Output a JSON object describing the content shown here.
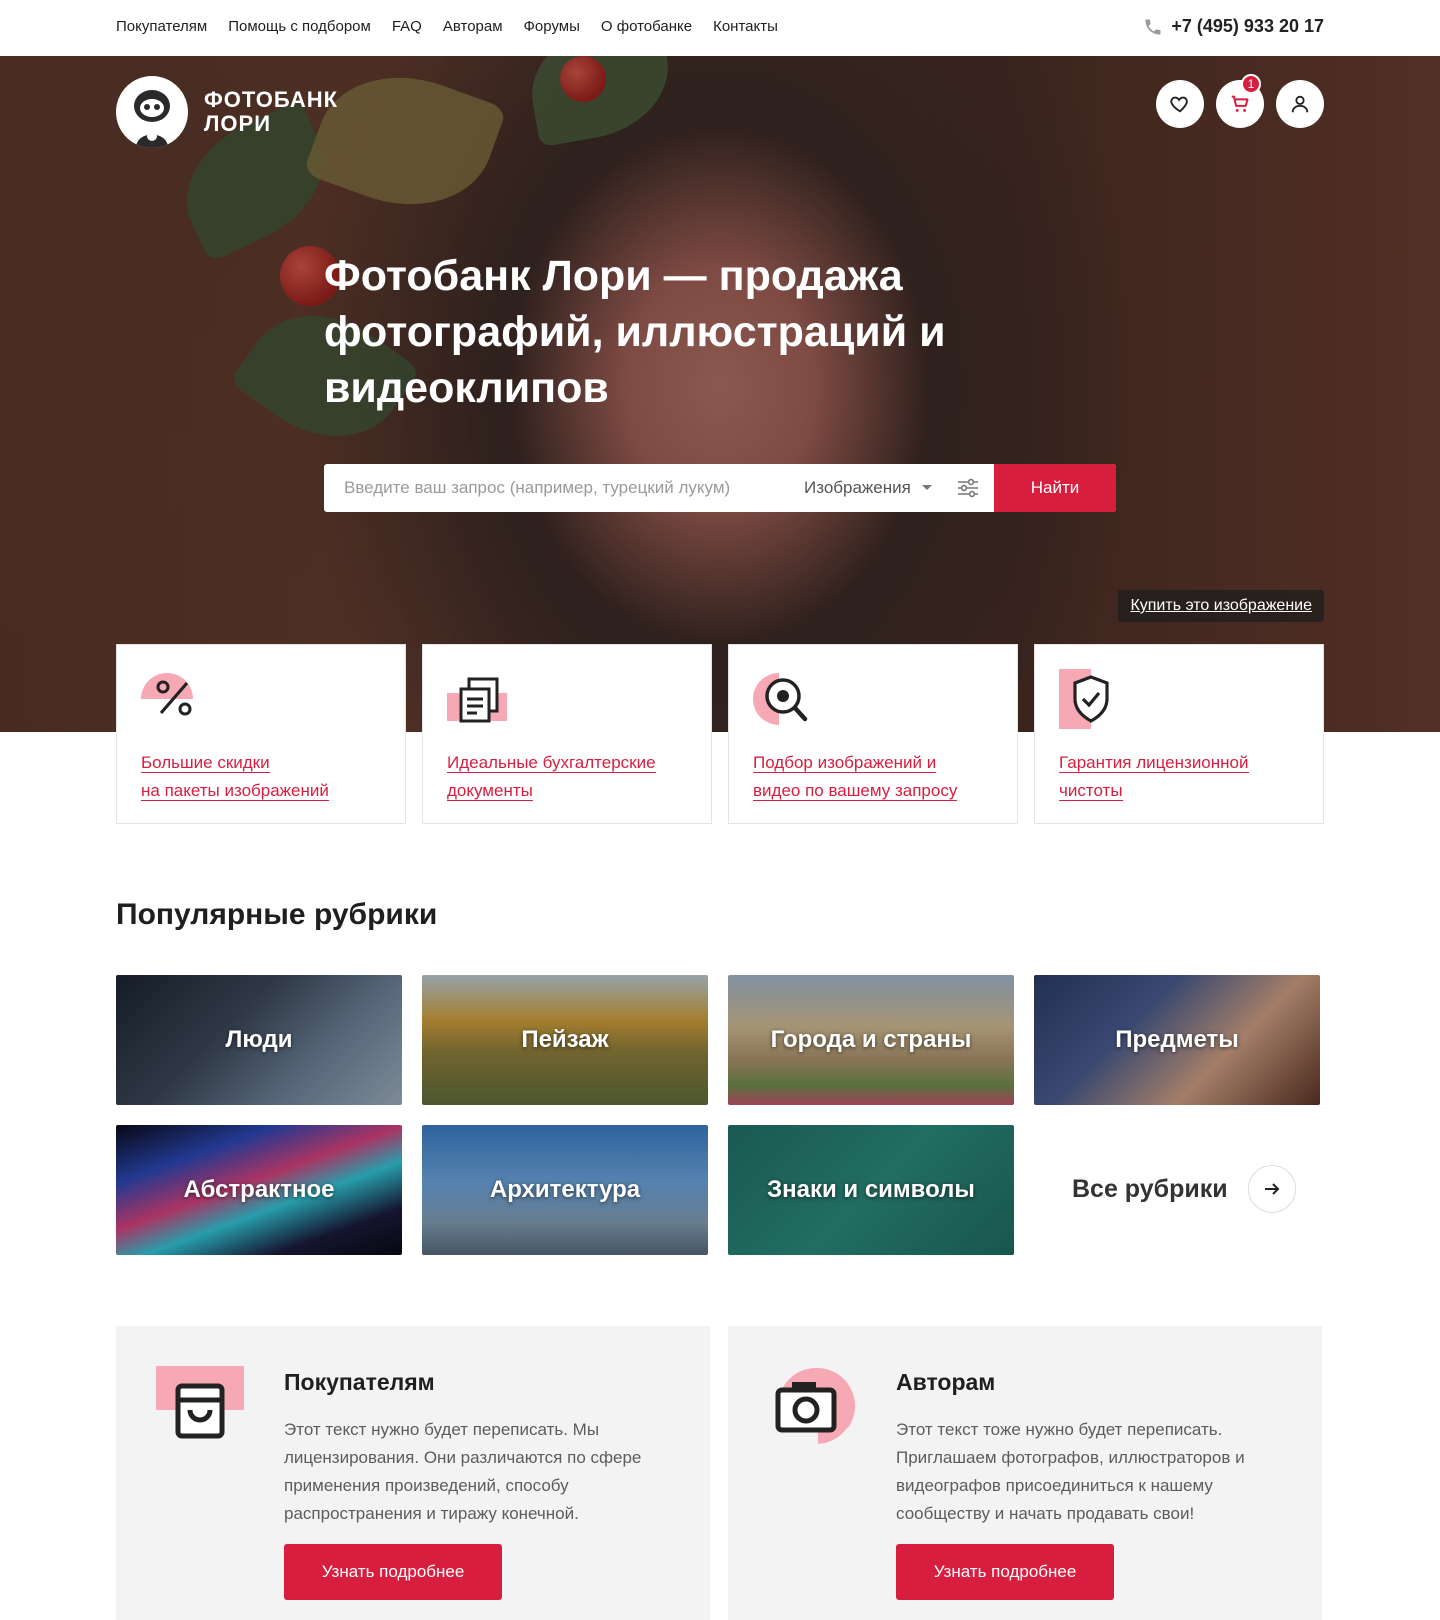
{
  "topnav": {
    "items": [
      "Покупателям",
      "Помощь с подбором",
      "FAQ",
      "Авторам",
      "Форумы",
      "О фотобанке",
      "Контакты"
    ],
    "phone": "+7 (495) 933 20 17"
  },
  "header": {
    "logo_line1": "ФОТОБАНК",
    "logo_line2": "ЛОРИ",
    "cart_count": "1"
  },
  "hero": {
    "title": "Фотобанк Лори — продажа фотографий, иллюстраций и видеоклипов",
    "search_placeholder": "Введите ваш запрос (например, турецкий лукум)",
    "search_type": "Изображения",
    "search_button": "Найти",
    "buy_link": "Купить это изображение"
  },
  "features": [
    {
      "line1": "Большие скидки",
      "line2": "на пакеты изображений"
    },
    {
      "line1": "Идеальные бухгалтерские",
      "line2": "документы"
    },
    {
      "line1": "Подбор изображений и",
      "line2": "видео по вашему запросу"
    },
    {
      "line1": "Гарантия лицензионной",
      "line2": "чистоты"
    }
  ],
  "popular": {
    "title": "Популярные рубрики",
    "tiles": [
      "Люди",
      "Пейзаж",
      "Города и страны",
      "Предметы",
      "Абстрактное",
      "Архитектура",
      "Знаки и символы"
    ],
    "all_label": "Все рубрики"
  },
  "info": [
    {
      "title": "Покупателям",
      "text": "Этот текст нужно будет переписать. Мы лицензирования. Они различаются по сфере применения произведений, способу распространения и тиражу конечной.",
      "button": "Узнать подробнее"
    },
    {
      "title": "Авторам",
      "text": "Этот текст тоже нужно будет переписать. Приглашаем фотографов, иллюстраторов и видеографов присоединиться к нашему сообществу и начать продавать свои!",
      "button": "Узнать подробнее"
    }
  ],
  "colors": {
    "accent": "#d81e3f",
    "accent_soft": "#f6a9b4",
    "panel_bg": "#f3f3f3"
  },
  "icons": [
    "phone-icon",
    "heart-icon",
    "cart-icon",
    "user-icon",
    "chevron-down-icon",
    "filter-icon",
    "percent-icon",
    "documents-icon",
    "search-eye-icon",
    "shield-check-icon",
    "arrow-right-icon",
    "shopping-bag-icon",
    "camera-icon"
  ]
}
